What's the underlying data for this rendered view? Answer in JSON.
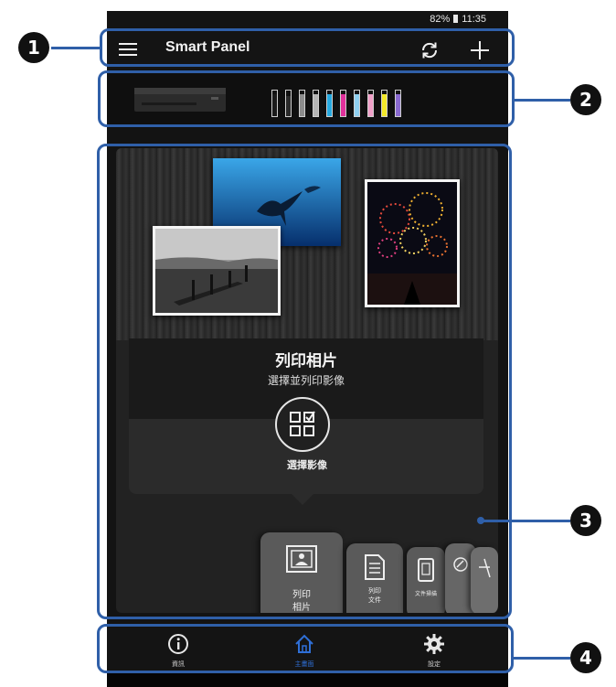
{
  "status_bar": {
    "battery": "82%",
    "time": "11:35"
  },
  "app_bar": {
    "title": "Smart Panel",
    "menu_icon": "hamburger-menu-icon",
    "refresh_icon": "refresh-icon",
    "add_icon": "plus-icon"
  },
  "printer": {
    "image": "printer-icon",
    "ink_levels": [
      {
        "color": "#1a1a1a",
        "level": 0.85
      },
      {
        "color": "#2a2a2a",
        "level": 0.8
      },
      {
        "color": "#8c8c8c",
        "level": 0.85
      },
      {
        "color": "#b5b5b5",
        "level": 0.85
      },
      {
        "color": "#25a9e0",
        "level": 0.85
      },
      {
        "color": "#e0309a",
        "level": 0.85
      },
      {
        "color": "#8fd0f0",
        "level": 0.85
      },
      {
        "color": "#f0a0c8",
        "level": 0.85
      },
      {
        "color": "#f3e92a",
        "level": 0.85
      },
      {
        "color": "#8a6ad0",
        "level": 0.85
      }
    ]
  },
  "feature": {
    "title": "列印相片",
    "subtitle": "選擇並列印影像",
    "action_label": "選擇影像",
    "action_icon": "select-grid-icon"
  },
  "carousel": [
    {
      "label": "列印\n相片",
      "icon": "photo-icon"
    },
    {
      "label": "列印\n文件",
      "icon": "document-icon"
    },
    {
      "label": "文件掃描",
      "icon": "scan-document-icon"
    },
    {
      "label": "",
      "icon": "edit-icon"
    },
    {
      "label": "",
      "icon": "more-icon"
    }
  ],
  "tabs": [
    {
      "label": "資訊",
      "icon": "info-icon",
      "active": false
    },
    {
      "label": "主畫面",
      "icon": "home-icon",
      "active": true
    },
    {
      "label": "設定",
      "icon": "gear-icon",
      "active": false
    }
  ],
  "callouts": [
    "1",
    "2",
    "3",
    "4"
  ],
  "colors": {
    "accent": "#2f6fd6",
    "highlight": "#2f5fa8"
  }
}
